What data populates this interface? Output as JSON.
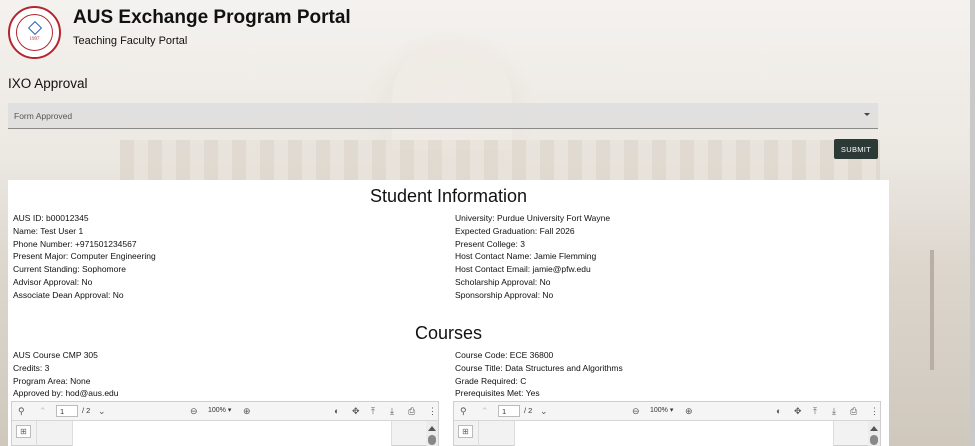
{
  "header": {
    "title": "AUS Exchange Program Portal",
    "subtitle": "Teaching Faculty Portal",
    "logo_year": "1997",
    "logo_icon": "university-seal-icon"
  },
  "approval": {
    "label": "IXO Approval",
    "selected": "Form Approved",
    "submit_label": "SUBMIT"
  },
  "student_info": {
    "heading": "Student Information",
    "left": [
      "AUS ID: b00012345",
      "Name: Test User 1",
      "Phone Number: +971501234567",
      "Present Major: Computer Engineering",
      "Current Standing: Sophomore",
      "Advisor Approval: No",
      "Associate Dean Approval: No"
    ],
    "right": [
      "University: Purdue University Fort Wayne",
      "Expected Graduation: Fall 2026",
      "Present College: 3",
      "Host Contact Name: Jamie Flemming",
      "Host Contact Email: jamie@pfw.edu",
      "Scholarship Approval: No",
      "Sponsorship Approval: No"
    ]
  },
  "courses": {
    "heading": "Courses",
    "left": [
      "AUS Course CMP 305",
      "Credits: 3",
      "Program Area: None",
      "Approved by: hod@aus.edu"
    ],
    "right": [
      "Course Code: ECE 36800",
      "Course Title: Data Structures and Algorithms",
      "Grade Required: C",
      "Prerequisites Met: Yes"
    ]
  },
  "pdf_viewer": {
    "page_value": "1",
    "page_count": "/ 2",
    "zoom": "100%",
    "icons": [
      "search-icon",
      "page-up-icon",
      "page-down-icon",
      "zoom-out-icon",
      "zoom-in-icon",
      "theme-icon",
      "pan-icon",
      "upload-icon",
      "download-icon",
      "print-icon",
      "more-icon",
      "thumbnails-icon"
    ]
  },
  "colors": {
    "submit_bg": "#2c3a37",
    "logo_red": "#b3262e"
  }
}
